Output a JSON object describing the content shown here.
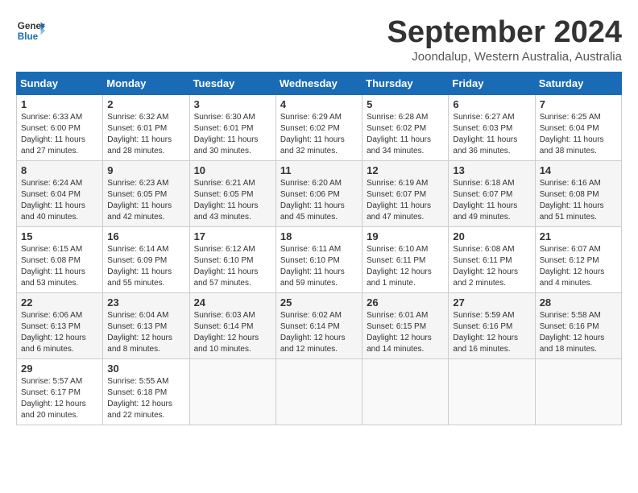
{
  "header": {
    "logo_line1": "General",
    "logo_line2": "Blue",
    "month": "September 2024",
    "location": "Joondalup, Western Australia, Australia"
  },
  "weekdays": [
    "Sunday",
    "Monday",
    "Tuesday",
    "Wednesday",
    "Thursday",
    "Friday",
    "Saturday"
  ],
  "weeks": [
    [
      {
        "day": "1",
        "info": "Sunrise: 6:33 AM\nSunset: 6:00 PM\nDaylight: 11 hours\nand 27 minutes."
      },
      {
        "day": "2",
        "info": "Sunrise: 6:32 AM\nSunset: 6:01 PM\nDaylight: 11 hours\nand 28 minutes."
      },
      {
        "day": "3",
        "info": "Sunrise: 6:30 AM\nSunset: 6:01 PM\nDaylight: 11 hours\nand 30 minutes."
      },
      {
        "day": "4",
        "info": "Sunrise: 6:29 AM\nSunset: 6:02 PM\nDaylight: 11 hours\nand 32 minutes."
      },
      {
        "day": "5",
        "info": "Sunrise: 6:28 AM\nSunset: 6:02 PM\nDaylight: 11 hours\nand 34 minutes."
      },
      {
        "day": "6",
        "info": "Sunrise: 6:27 AM\nSunset: 6:03 PM\nDaylight: 11 hours\nand 36 minutes."
      },
      {
        "day": "7",
        "info": "Sunrise: 6:25 AM\nSunset: 6:04 PM\nDaylight: 11 hours\nand 38 minutes."
      }
    ],
    [
      {
        "day": "8",
        "info": "Sunrise: 6:24 AM\nSunset: 6:04 PM\nDaylight: 11 hours\nand 40 minutes."
      },
      {
        "day": "9",
        "info": "Sunrise: 6:23 AM\nSunset: 6:05 PM\nDaylight: 11 hours\nand 42 minutes."
      },
      {
        "day": "10",
        "info": "Sunrise: 6:21 AM\nSunset: 6:05 PM\nDaylight: 11 hours\nand 43 minutes."
      },
      {
        "day": "11",
        "info": "Sunrise: 6:20 AM\nSunset: 6:06 PM\nDaylight: 11 hours\nand 45 minutes."
      },
      {
        "day": "12",
        "info": "Sunrise: 6:19 AM\nSunset: 6:07 PM\nDaylight: 11 hours\nand 47 minutes."
      },
      {
        "day": "13",
        "info": "Sunrise: 6:18 AM\nSunset: 6:07 PM\nDaylight: 11 hours\nand 49 minutes."
      },
      {
        "day": "14",
        "info": "Sunrise: 6:16 AM\nSunset: 6:08 PM\nDaylight: 11 hours\nand 51 minutes."
      }
    ],
    [
      {
        "day": "15",
        "info": "Sunrise: 6:15 AM\nSunset: 6:08 PM\nDaylight: 11 hours\nand 53 minutes."
      },
      {
        "day": "16",
        "info": "Sunrise: 6:14 AM\nSunset: 6:09 PM\nDaylight: 11 hours\nand 55 minutes."
      },
      {
        "day": "17",
        "info": "Sunrise: 6:12 AM\nSunset: 6:10 PM\nDaylight: 11 hours\nand 57 minutes."
      },
      {
        "day": "18",
        "info": "Sunrise: 6:11 AM\nSunset: 6:10 PM\nDaylight: 11 hours\nand 59 minutes."
      },
      {
        "day": "19",
        "info": "Sunrise: 6:10 AM\nSunset: 6:11 PM\nDaylight: 12 hours\nand 1 minute."
      },
      {
        "day": "20",
        "info": "Sunrise: 6:08 AM\nSunset: 6:11 PM\nDaylight: 12 hours\nand 2 minutes."
      },
      {
        "day": "21",
        "info": "Sunrise: 6:07 AM\nSunset: 6:12 PM\nDaylight: 12 hours\nand 4 minutes."
      }
    ],
    [
      {
        "day": "22",
        "info": "Sunrise: 6:06 AM\nSunset: 6:13 PM\nDaylight: 12 hours\nand 6 minutes."
      },
      {
        "day": "23",
        "info": "Sunrise: 6:04 AM\nSunset: 6:13 PM\nDaylight: 12 hours\nand 8 minutes."
      },
      {
        "day": "24",
        "info": "Sunrise: 6:03 AM\nSunset: 6:14 PM\nDaylight: 12 hours\nand 10 minutes."
      },
      {
        "day": "25",
        "info": "Sunrise: 6:02 AM\nSunset: 6:14 PM\nDaylight: 12 hours\nand 12 minutes."
      },
      {
        "day": "26",
        "info": "Sunrise: 6:01 AM\nSunset: 6:15 PM\nDaylight: 12 hours\nand 14 minutes."
      },
      {
        "day": "27",
        "info": "Sunrise: 5:59 AM\nSunset: 6:16 PM\nDaylight: 12 hours\nand 16 minutes."
      },
      {
        "day": "28",
        "info": "Sunrise: 5:58 AM\nSunset: 6:16 PM\nDaylight: 12 hours\nand 18 minutes."
      }
    ],
    [
      {
        "day": "29",
        "info": "Sunrise: 5:57 AM\nSunset: 6:17 PM\nDaylight: 12 hours\nand 20 minutes."
      },
      {
        "day": "30",
        "info": "Sunrise: 5:55 AM\nSunset: 6:18 PM\nDaylight: 12 hours\nand 22 minutes."
      },
      {
        "day": "",
        "info": ""
      },
      {
        "day": "",
        "info": ""
      },
      {
        "day": "",
        "info": ""
      },
      {
        "day": "",
        "info": ""
      },
      {
        "day": "",
        "info": ""
      }
    ]
  ]
}
